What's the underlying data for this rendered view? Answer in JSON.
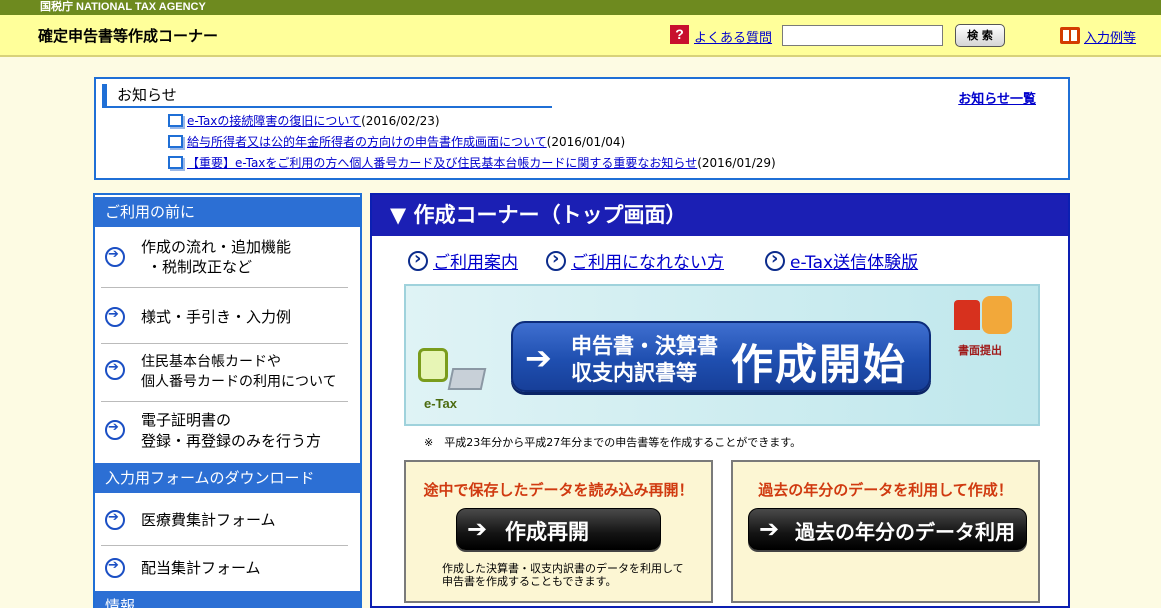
{
  "agency": {
    "label": "国税庁 NATIONAL TAX AGENCY"
  },
  "header": {
    "site_title": "確定申告書等作成コーナー",
    "faq_icon": "question-icon",
    "faq_label": "よくある質問",
    "search_value": "",
    "search_button": "検 索",
    "input_example_icon": "book-icon",
    "input_example_label": "入力例等"
  },
  "notices": {
    "heading": "お知らせ",
    "all_link": "お知らせ一覧",
    "items": [
      {
        "title": "e-Taxの接続障害の復旧について",
        "date": "(2016/02/23)"
      },
      {
        "title": "給与所得者又は公的年金所得者の方向けの申告書作成画面について",
        "date": "(2016/01/04)"
      },
      {
        "title": "【重要】e-Taxをご利用の方へ個人番号カード及び住民基本台帳カードに関する重要なお知らせ",
        "date": "(2016/01/29)"
      }
    ]
  },
  "sidebar": {
    "sections": [
      {
        "heading": "ご利用の前に"
      },
      {
        "heading": "入力用フォームのダウンロード"
      },
      {
        "heading": "情報"
      }
    ],
    "items": [
      {
        "line1": "作成の流れ・追加機能",
        "line2": "・税制改正など"
      },
      {
        "line1": "様式・手引き・入力例"
      },
      {
        "line1": "住民基本台帳カードや",
        "line2": "個人番号カードの利用について"
      },
      {
        "line1": "電子証明書の",
        "line2": "登録・再登録のみを行う方"
      },
      {
        "line1": "医療費集計フォーム"
      },
      {
        "line1": "配当集計フォーム"
      }
    ]
  },
  "main": {
    "heading": "▼ 作成コーナー（トップ画面）",
    "links": [
      {
        "label": "ご利用案内"
      },
      {
        "label": "ご利用になれない方"
      },
      {
        "label": "e-Tax送信体験版"
      }
    ],
    "start": {
      "line1": "申告書・決算書",
      "line2": "収支内訳書等",
      "big": "作成開始",
      "etax_label": "e-Tax",
      "paper_label": "書面提出"
    },
    "note": "※　平成23年分から平成27年分までの申告書等を作成することができます。",
    "resume": {
      "title": "途中で保存したデータを読み込み再開！",
      "button": "作成再開",
      "desc_line1": "作成した決算書・収支内訳書のデータを利用して",
      "desc_line2": "申告書を作成することもできます。"
    },
    "past": {
      "title": "過去の年分のデータを利用して作成！",
      "button": "過去の年分のデータ利用"
    }
  }
}
